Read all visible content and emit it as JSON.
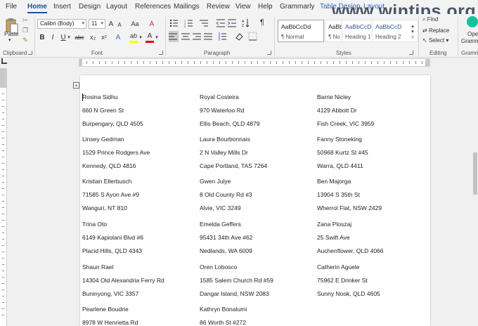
{
  "tabs": [
    {
      "label": "File"
    },
    {
      "label": "Home"
    },
    {
      "label": "Insert"
    },
    {
      "label": "Design"
    },
    {
      "label": "Layout"
    },
    {
      "label": "References"
    },
    {
      "label": "Mailings"
    },
    {
      "label": "Review"
    },
    {
      "label": "View"
    },
    {
      "label": "Help"
    },
    {
      "label": "Grammarly"
    },
    {
      "label": "Table Design"
    },
    {
      "label": "Layout"
    }
  ],
  "watermark": "www.wintips.org",
  "clipboard": {
    "paste_label": "Paste",
    "group_label": "Clipboard"
  },
  "font": {
    "name": "Calibri (Body)",
    "size": "11",
    "group_label": "Font",
    "bold": "B",
    "italic": "I",
    "underline": "U",
    "strike": "abc",
    "subscript": "x₂",
    "superscript": "x²",
    "clear": "A",
    "grow": "A",
    "shrink": "A",
    "case": "Aa",
    "highlight_color": "#ffff00",
    "font_color": "#e00000",
    "font_color_letter": "A",
    "highlight_letter": "ab"
  },
  "paragraph": {
    "group_label": "Paragraph",
    "pilcrow": "¶"
  },
  "styles": {
    "group_label": "Styles",
    "items": [
      {
        "preview": "AaBbCcDd",
        "name": "¶ Normal"
      },
      {
        "preview": "AaBbCcDd",
        "name": "¶ No Spac..."
      },
      {
        "preview": "AaBbCcDd",
        "name": "Heading 1"
      },
      {
        "preview": "AaBbCcD",
        "name": "Heading 2"
      }
    ]
  },
  "editing": {
    "group_label": "Editing",
    "find": "Find",
    "replace": "Replace",
    "select": "Select"
  },
  "grammarly": {
    "group_label": "Gramm",
    "open_label": "Ope",
    "open_label2": "Gramm"
  },
  "labels": [
    [
      "Rosina Sidhu",
      "660 N Green St",
      "Burpengary, QLD 4505"
    ],
    [
      "Royal Costeira",
      "970 Waterloo Rd",
      "Ellis Beach, QLD 4879"
    ],
    [
      "Barrie Nicley",
      "4129 Abbott Dr",
      "Fish Creek, VIC 3959"
    ],
    [
      "Linsey Gedman",
      "1529 Prince Rodgers Ave",
      "Kennedy, QLD 4816"
    ],
    [
      "Laura Bourbonnais",
      "2 N Valley Mills Dr",
      "Cape Portland, TAS 7264"
    ],
    [
      "Fanny Stoneking",
      "50968 Kurtz St #45",
      "Warra, QLD 4411"
    ],
    [
      "Kristian Ellerbusch",
      "71585 S Ayon Ave #9",
      "Wanguri, NT 810"
    ],
    [
      "Gwen Julye",
      "8 Old County Rd #3",
      "Alvie, VIC 3249"
    ],
    [
      "Ben Majorga",
      "13904 S 35th St",
      "Wherrol Flat, NSW 2429"
    ],
    [
      "Trina Oto",
      "6149 Kapiolani Blvd #6",
      "Placid Hills, QLD 4343"
    ],
    [
      "Emelda Geffers",
      "95431 34th Ave #62",
      "Nedlands, WA 6009"
    ],
    [
      "Zana Ploszaj",
      "25 Swift Ave",
      "Auchenflower, QLD 4066"
    ],
    [
      "Shaun Rael",
      "14304 Old Alexandria Ferry Rd",
      "Buninyong, VIC 3357"
    ],
    [
      "Oren Lobosco",
      "1585 Salem Church Rd #59",
      "Dangar Island, NSW 2083"
    ],
    [
      "Catherin Aguele",
      "75962 E Drinker St",
      "Sunny Nook, QLD 4605"
    ],
    [
      "Pearlene Boudrie",
      "8978 W Henrietta Rd",
      ""
    ],
    [
      "Kathryn Bonalumi",
      "86 Worth St #272",
      ""
    ]
  ]
}
